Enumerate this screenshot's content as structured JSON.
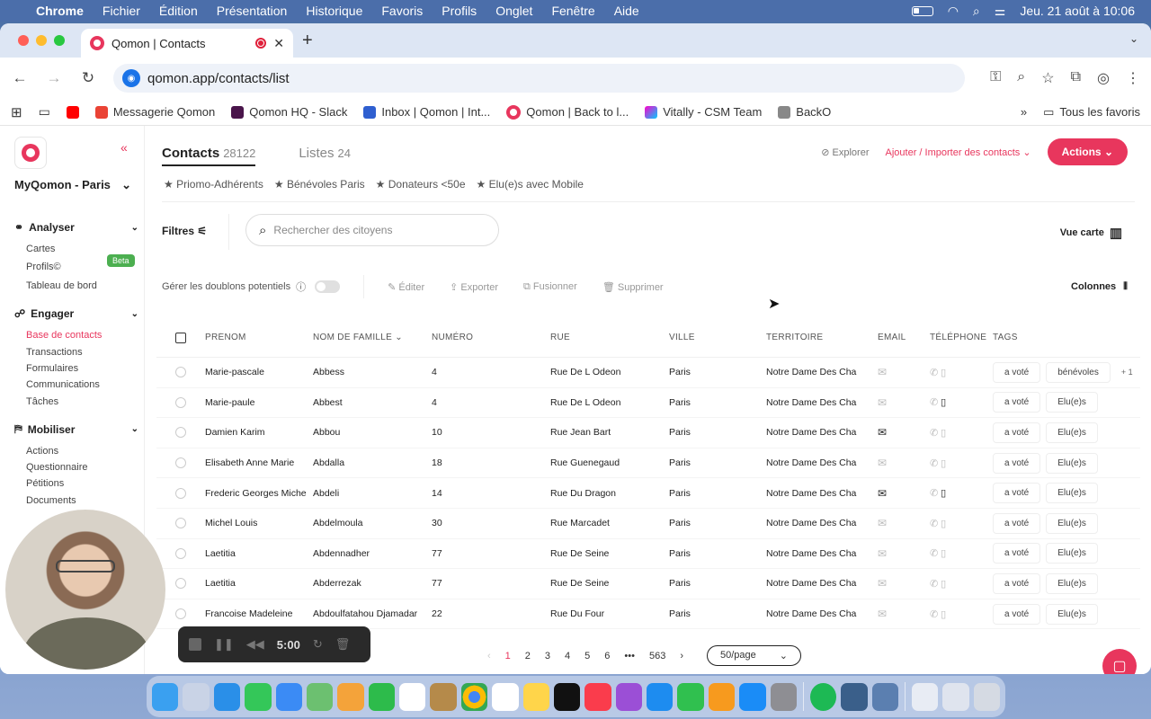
{
  "menubar": {
    "app": "Chrome",
    "items": [
      "Fichier",
      "Édition",
      "Présentation",
      "Historique",
      "Favoris",
      "Profils",
      "Onglet",
      "Fenêtre",
      "Aide"
    ],
    "datetime": "Jeu. 21 août à  10:06"
  },
  "browser": {
    "tab_title": "Qomon | Contacts",
    "url": "qomon.app/contacts/list",
    "bookmarks": [
      "Messagerie Qomon",
      "Qomon HQ - Slack",
      "Inbox | Qomon | Int...",
      "Qomon | Back to l...",
      "Vitally - CSM Team",
      "BackO"
    ],
    "all_bookmarks": "Tous les favoris"
  },
  "sidebar": {
    "org": "MyQomon - Paris",
    "sections": [
      {
        "label": "Analyser",
        "items": [
          "Cartes",
          "Profils©",
          "Tableau de bord"
        ]
      },
      {
        "label": "Engager",
        "items": [
          "Base de contacts",
          "Transactions",
          "Formulaires",
          "Communications",
          "Tâches"
        ]
      },
      {
        "label": "Mobiliser",
        "items": [
          "Actions",
          "Questionnaire",
          "Pétitions",
          "Documents"
        ]
      }
    ],
    "beta": "Beta"
  },
  "header": {
    "tab_contacts": "Contacts",
    "contacts_count": "28122",
    "tab_lists": "Listes",
    "lists_count": "24",
    "explore": "Explorer",
    "import": "Ajouter / Importer des contacts",
    "actions": "Actions"
  },
  "saved_filters": [
    "Priomo-Adhérents",
    "Bénévoles Paris",
    "Donateurs <50e",
    "Elu(e)s avec Mobile"
  ],
  "toolbar": {
    "filters": "Filtres",
    "search_placeholder": "Rechercher des citoyens",
    "map_view": "Vue carte",
    "duplicates": "Gérer les doublons potentiels",
    "edit": "Éditer",
    "export": "Exporter",
    "merge": "Fusionner",
    "delete": "Supprimer",
    "columns": "Colonnes"
  },
  "table": {
    "headers": [
      "PRÉNOM",
      "NOM DE FAMILLE",
      "NUMÉRO",
      "RUE",
      "VILLE",
      "TERRITOIRE",
      "EMAIL",
      "TÉLÉPHONE",
      "TAGS"
    ],
    "rows": [
      {
        "first": "Marie-pascale",
        "last": "Abbess",
        "num": "4",
        "street": "Rue De L Odeon",
        "city": "Paris",
        "territory": "Notre Dame Des Cha",
        "email_on": false,
        "phone_on": false,
        "tag1": "a voté",
        "tag2": "bénévoles",
        "more": "+ 1"
      },
      {
        "first": "Marie-paule",
        "last": "Abbest",
        "num": "4",
        "street": "Rue De L Odeon",
        "city": "Paris",
        "territory": "Notre Dame Des Cha",
        "email_on": false,
        "phone_on": true,
        "tag1": "a voté",
        "tag2": "Elu(e)s",
        "more": ""
      },
      {
        "first": "Damien Karim",
        "last": "Abbou",
        "num": "10",
        "street": "Rue Jean Bart",
        "city": "Paris",
        "territory": "Notre Dame Des Cha",
        "email_on": true,
        "phone_on": false,
        "tag1": "a voté",
        "tag2": "Elu(e)s",
        "more": ""
      },
      {
        "first": "Elisabeth Anne Marie",
        "last": "Abdalla",
        "num": "18",
        "street": "Rue Guenegaud",
        "city": "Paris",
        "territory": "Notre Dame Des Cha",
        "email_on": false,
        "phone_on": false,
        "tag1": "a voté",
        "tag2": "Elu(e)s",
        "more": ""
      },
      {
        "first": "Frederic Georges Miche",
        "last": "Abdeli",
        "num": "14",
        "street": "Rue Du Dragon",
        "city": "Paris",
        "territory": "Notre Dame Des Cha",
        "email_on": true,
        "phone_on": true,
        "tag1": "a voté",
        "tag2": "Elu(e)s",
        "more": ""
      },
      {
        "first": "Michel Louis",
        "last": "Abdelmoula",
        "num": "30",
        "street": "Rue Marcadet",
        "city": "Paris",
        "territory": "Notre Dame Des Cha",
        "email_on": false,
        "phone_on": false,
        "tag1": "a voté",
        "tag2": "Elu(e)s",
        "more": ""
      },
      {
        "first": "Laetitia",
        "last": "Abdennadher",
        "num": "77",
        "street": "Rue De Seine",
        "city": "Paris",
        "territory": "Notre Dame Des Cha",
        "email_on": false,
        "phone_on": false,
        "tag1": "a voté",
        "tag2": "Elu(e)s",
        "more": ""
      },
      {
        "first": "Laetitia",
        "last": "Abderrezak",
        "num": "77",
        "street": "Rue De Seine",
        "city": "Paris",
        "territory": "Notre Dame Des Cha",
        "email_on": false,
        "phone_on": false,
        "tag1": "a voté",
        "tag2": "Elu(e)s",
        "more": ""
      },
      {
        "first": "Francoise Madeleine",
        "last": "Abdoulfatahou Djamadar",
        "num": "22",
        "street": "Rue Du Four",
        "city": "Paris",
        "territory": "Notre Dame Des Cha",
        "email_on": false,
        "phone_on": false,
        "tag1": "a voté",
        "tag2": "Elu(e)s",
        "more": ""
      }
    ]
  },
  "pagination": {
    "pages": [
      "1",
      "2",
      "3",
      "4",
      "5",
      "6",
      "•••",
      "563"
    ],
    "current": "1",
    "per_page": "50/page"
  },
  "recorder": {
    "time": "5:00"
  },
  "colors": {
    "accent": "#e8365d",
    "menubar": "#4b6eaa"
  }
}
